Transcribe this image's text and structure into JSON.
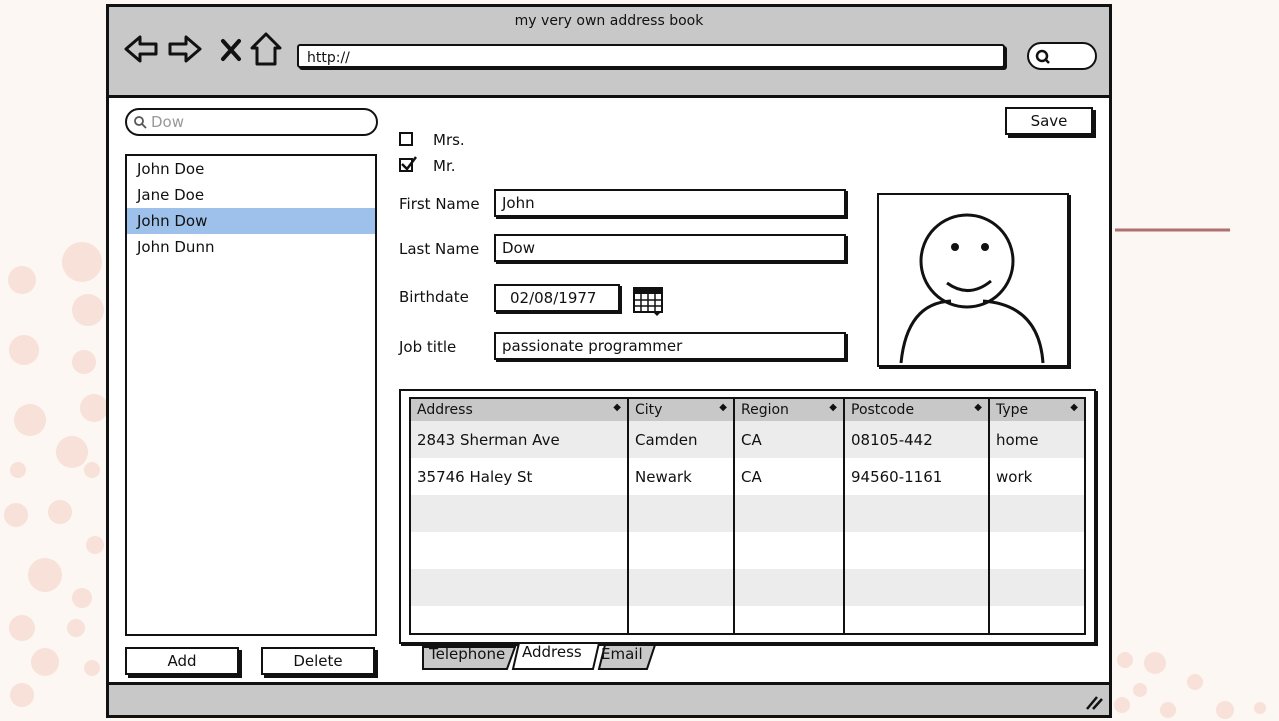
{
  "window": {
    "title": "my very own address book"
  },
  "browser": {
    "url": "http://"
  },
  "search": {
    "value": "Dow"
  },
  "contacts": [
    "John Doe",
    "Jane Doe",
    "John Dow",
    "John Dunn"
  ],
  "selected_contact": "John Dow",
  "buttons": {
    "save": "Save",
    "add": "Add",
    "delete": "Delete"
  },
  "salutation": {
    "mrs": {
      "label": "Mrs.",
      "checked": false
    },
    "mr": {
      "label": "Mr.",
      "checked": true
    }
  },
  "form": {
    "first_name": {
      "label": "First Name",
      "value": "John"
    },
    "last_name": {
      "label": "Last Name",
      "value": "Dow"
    },
    "birthdate": {
      "label": "Birthdate",
      "value": "02/08/1977"
    },
    "job_title": {
      "label": "Job title",
      "value": "passionate programmer"
    }
  },
  "address_table": {
    "columns": [
      "Address",
      "City",
      "Region",
      "Postcode",
      "Type"
    ],
    "rows": [
      [
        "2843 Sherman Ave",
        "Camden",
        "CA",
        "08105-442",
        "home"
      ],
      [
        "35746 Haley St",
        "Newark",
        "CA",
        "94560-1161",
        "work"
      ],
      [
        "",
        "",
        "",
        "",
        ""
      ],
      [
        "",
        "",
        "",
        "",
        ""
      ],
      [
        "",
        "",
        "",
        "",
        ""
      ],
      [
        "",
        "",
        "",
        "",
        ""
      ]
    ]
  },
  "tabs": [
    "Telephone",
    "Address",
    "Email"
  ],
  "active_tab": "Address",
  "colors": {
    "selection": "#9ec1ec",
    "chrome": "#c8c8c8",
    "background": "#fdf7f4"
  }
}
